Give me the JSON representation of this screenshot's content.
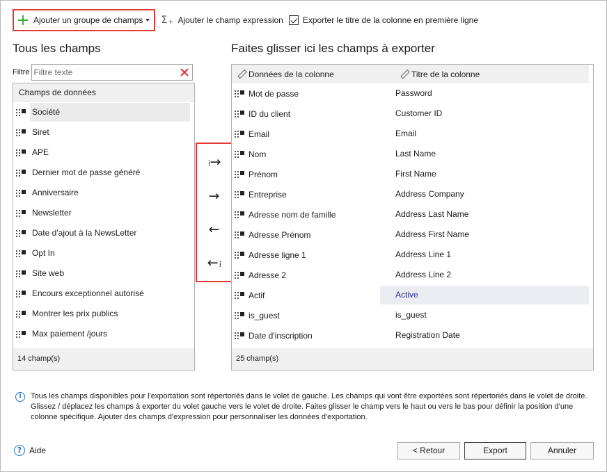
{
  "toolbar": {
    "add_group_label": "Ajouter un groupe de champs",
    "add_expression_label": "Ajouter le champ expression",
    "export_title_label": "Exporter le titre de la colonne en première ligne",
    "export_title_checked": true
  },
  "left": {
    "title": "Tous les champs",
    "filter_label": "Filtre",
    "filter_placeholder": "Filtre texte",
    "header": "Champs de données",
    "items": [
      {
        "label": "Société"
      },
      {
        "label": "Siret"
      },
      {
        "label": "APE"
      },
      {
        "label": "Dernier mot de passe généré"
      },
      {
        "label": "Anniversaire"
      },
      {
        "label": "Newsletter"
      },
      {
        "label": "Date d'ajout à la NewsLetter"
      },
      {
        "label": "Opt In"
      },
      {
        "label": "Site web"
      },
      {
        "label": "Encours exceptionnel autorisé"
      },
      {
        "label": "Montrer les prix publics"
      },
      {
        "label": "Max paiement /jours"
      }
    ],
    "selected_index": 0,
    "footer": "14 champ(s)"
  },
  "arrows": {
    "add_all": "⇢",
    "add": "→",
    "remove": "←",
    "remove_all": "⇠"
  },
  "right": {
    "title": "Faites glisser ici les champs à exporter",
    "col_data": "Données de la colonne",
    "col_title": "Titre de la colonne",
    "rows": [
      {
        "data": "Mot de passe",
        "title": "Password"
      },
      {
        "data": "ID du client",
        "title": "Customer ID"
      },
      {
        "data": "Email",
        "title": "Email"
      },
      {
        "data": "Nom",
        "title": "Last Name"
      },
      {
        "data": "Prénom",
        "title": "First Name"
      },
      {
        "data": "Entreprise",
        "title": "Address Company"
      },
      {
        "data": "Adresse nom de famille",
        "title": "Address Last Name"
      },
      {
        "data": "Adresse Prénom",
        "title": "Address First Name"
      },
      {
        "data": "Adresse ligne 1",
        "title": "Address Line 1"
      },
      {
        "data": "Adresse 2",
        "title": "Address Line 2"
      },
      {
        "data": "Actif",
        "title": "Active"
      },
      {
        "data": "is_guest",
        "title": "is_guest"
      },
      {
        "data": "Date d'inscription",
        "title": "Registration Date"
      }
    ],
    "highlight_index": 10,
    "footer": "25 champ(s)"
  },
  "info": {
    "text": "Tous les champs disponibles pour l'exportation sont répertoriés dans le volet de gauche. Les champs qui vont être exportées sont répertoriés dans le volet de droite. Glissez / déplacez les champs à exporter du volet gauche vers le volet de droite. Faites glisser le champ vers le haut ou vers le bas pour définir la position d'une colonne spécifique. Ajouter des champs d'expression pour personnaliser les données d'exportation."
  },
  "footer": {
    "help_label": "Aide",
    "back_label": "< Retour",
    "export_label": "Export",
    "cancel_label": "Annuler"
  },
  "colors": {
    "accent_red": "#e53935",
    "plus_green": "#3cae3c",
    "info_blue": "#2a6fc9",
    "highlight_text": "#2a2f8a"
  },
  "icons": {
    "add_group": "plus-icon",
    "expression": "sigma-icon",
    "filter_clear": "close-icon",
    "grip": "drag-handle-icon",
    "column_header": "pencil-icon",
    "info": "info-icon",
    "help": "help-icon"
  }
}
